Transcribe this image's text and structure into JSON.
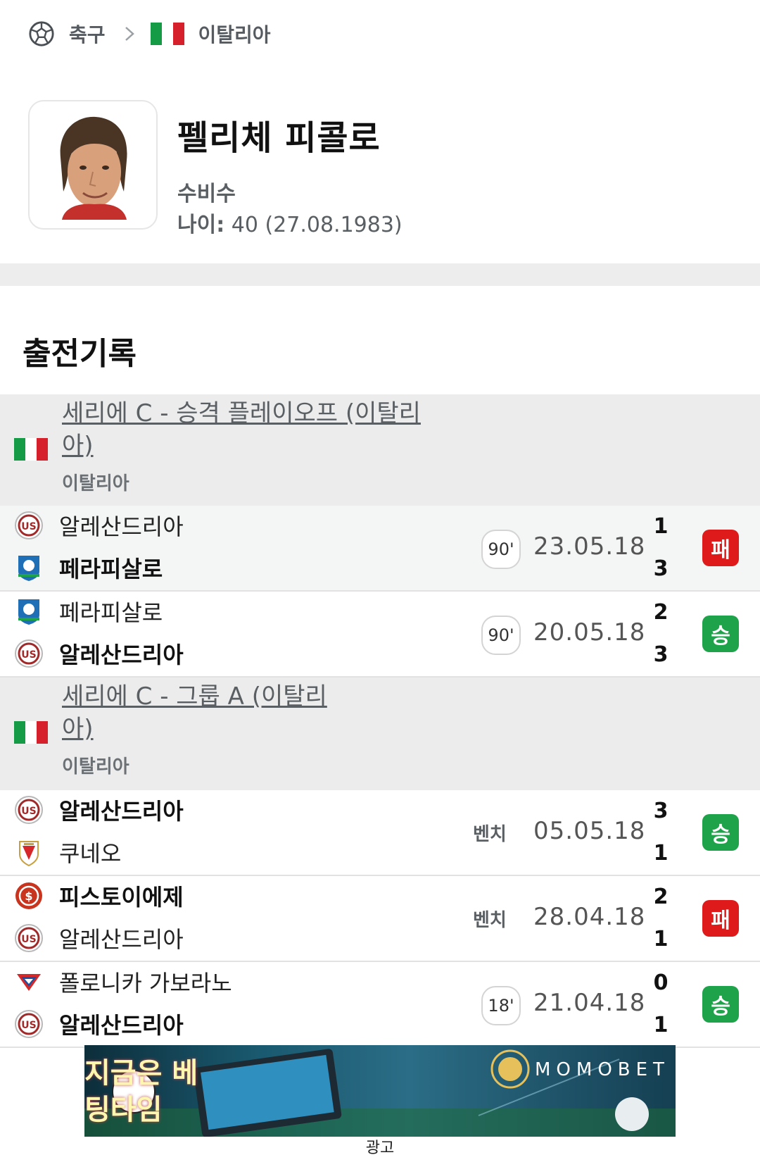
{
  "breadcrumb": {
    "sport": "축구",
    "country": "이탈리아"
  },
  "player": {
    "name": "펠리체 피콜로",
    "position": "수비수",
    "age_label": "나이:",
    "age_value": "40 (27.08.1983)"
  },
  "section_title": "출전기록",
  "leagues": [
    {
      "name": "세리에 C - 승격 플레이오프 (이탈리아)",
      "country": "이탈리아",
      "matches": [
        {
          "home": "알레산드리아",
          "away": "페라피살로",
          "home_bold": false,
          "away_bold": true,
          "minutes": "90'",
          "date": "23.05.18",
          "home_score": "1",
          "away_score": "3",
          "result": "패",
          "result_type": "loss"
        },
        {
          "home": "페라피살로",
          "away": "알레산드리아",
          "home_bold": false,
          "away_bold": true,
          "minutes": "90'",
          "date": "20.05.18",
          "home_score": "2",
          "away_score": "3",
          "result": "승",
          "result_type": "win"
        }
      ]
    },
    {
      "name": "세리에 C - 그룹 A (이탈리아)",
      "country": "이탈리아",
      "matches": [
        {
          "home": "알레산드리아",
          "away": "쿠네오",
          "home_bold": true,
          "away_bold": false,
          "bench": "벤치",
          "date": "05.05.18",
          "home_score": "3",
          "away_score": "1",
          "result": "승",
          "result_type": "win"
        },
        {
          "home": "피스토이에제",
          "away": "알레산드리아",
          "home_bold": true,
          "away_bold": false,
          "bench": "벤치",
          "date": "28.04.18",
          "home_score": "2",
          "away_score": "1",
          "result": "패",
          "result_type": "loss"
        },
        {
          "home": "폴로니카 가보라노",
          "away": "알레산드리아",
          "home_bold": false,
          "away_bold": true,
          "minutes": "18'",
          "date": "21.04.18",
          "home_score": "0",
          "away_score": "1",
          "result": "승",
          "result_type": "win"
        }
      ]
    }
  ],
  "ad": {
    "headline": "지금은 베팅타임",
    "brand": "MOMOBET",
    "label": "광고"
  },
  "colors": {
    "win": "#1fa34a",
    "loss": "#df1a1a",
    "italy_green": "#159a46",
    "italy_red": "#d6202b"
  },
  "icons": [
    "soccer-ball-icon",
    "chevron-right-icon",
    "italy-flag-icon"
  ]
}
